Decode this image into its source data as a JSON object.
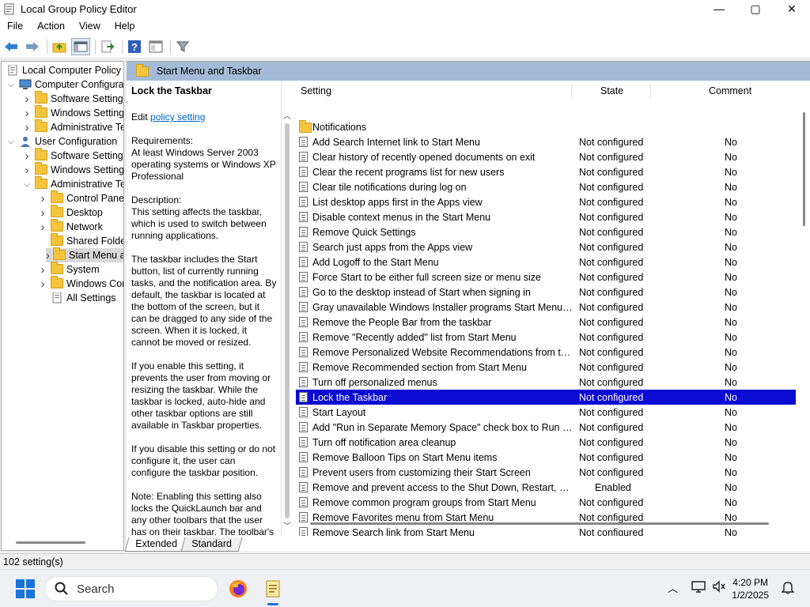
{
  "window": {
    "title": "Local Group Policy Editor",
    "controls": {
      "minimize": "—",
      "maximize": "▢",
      "close": "✕"
    }
  },
  "menu": [
    "File",
    "Action",
    "View",
    "Help"
  ],
  "toolbar": {
    "icons": [
      "back-arrow-icon",
      "forward-arrow-icon",
      "up-folder-icon",
      "show-hide-tree-icon",
      "export-list-icon",
      "help-icon",
      "properties-icon",
      "filter-icon"
    ]
  },
  "tree": [
    {
      "label": "Local Computer Policy",
      "level": 0,
      "expander": "",
      "icon": "computer-policy"
    },
    {
      "label": "Computer Configura",
      "level": 1,
      "expander": "down",
      "icon": "computer"
    },
    {
      "label": "Software Settings",
      "level": 2,
      "expander": "right",
      "icon": "folder"
    },
    {
      "label": "Windows Setting",
      "level": 2,
      "expander": "right",
      "icon": "folder"
    },
    {
      "label": "Administrative Te",
      "level": 2,
      "expander": "right",
      "icon": "folder"
    },
    {
      "label": "User Configuration",
      "level": 1,
      "expander": "down",
      "icon": "user"
    },
    {
      "label": "Software Settings",
      "level": 2,
      "expander": "right",
      "icon": "folder"
    },
    {
      "label": "Windows Setting",
      "level": 2,
      "expander": "right",
      "icon": "folder"
    },
    {
      "label": "Administrative Te",
      "level": 2,
      "expander": "down",
      "icon": "folder"
    },
    {
      "label": "Control Panel",
      "level": 3,
      "expander": "right",
      "icon": "folder"
    },
    {
      "label": "Desktop",
      "level": 3,
      "expander": "right",
      "icon": "folder"
    },
    {
      "label": "Network",
      "level": 3,
      "expander": "right",
      "icon": "folder"
    },
    {
      "label": "Shared Folder",
      "level": 3,
      "expander": "",
      "icon": "folder"
    },
    {
      "label": "Start Menu ar",
      "level": 3,
      "expander": "right",
      "icon": "folder",
      "selected": true
    },
    {
      "label": "System",
      "level": 3,
      "expander": "right",
      "icon": "folder"
    },
    {
      "label": "Windows Cor",
      "level": 3,
      "expander": "right",
      "icon": "folder"
    },
    {
      "label": "All Settings",
      "level": 3,
      "expander": "",
      "icon": "all-settings"
    }
  ],
  "header": {
    "title": "Start Menu and Taskbar"
  },
  "description": {
    "setting_title": "Lock the Taskbar",
    "edit_prefix": "Edit ",
    "edit_link": "policy setting",
    "requirements_label": "Requirements:",
    "requirements": "At least Windows Server 2003 operating systems or Windows XP Professional",
    "description_label": "Description:",
    "p1": "This setting affects the taskbar, which is used to switch between running applications.",
    "p2": "The taskbar includes the Start button, list of currently running tasks, and the notification area. By default, the taskbar is located at the bottom of the screen, but it can be dragged to any side of the screen. When it is locked, it cannot be moved or resized.",
    "p3": "If you enable this setting, it prevents the user from moving or resizing the taskbar. While the taskbar is locked, auto-hide and other taskbar options are still available in Taskbar properties.",
    "p4": "If you disable this setting or do not configure it, the user can configure the taskbar position.",
    "p5": "Note: Enabling this setting also locks the QuickLaunch bar and any other toolbars that the user has on their taskbar. The toolbar's"
  },
  "columns": {
    "setting": "Setting",
    "state": "State",
    "comment": "Comment"
  },
  "rows": [
    {
      "name": "Notifications",
      "state": "",
      "comment": "",
      "type": "folder"
    },
    {
      "name": "Add Search Internet link to Start Menu",
      "state": "Not configured",
      "comment": "No"
    },
    {
      "name": "Clear history of recently opened documents on exit",
      "state": "Not configured",
      "comment": "No"
    },
    {
      "name": "Clear the recent programs list for new users",
      "state": "Not configured",
      "comment": "No"
    },
    {
      "name": "Clear tile notifications during log on",
      "state": "Not configured",
      "comment": "No"
    },
    {
      "name": "List desktop apps first in the Apps view",
      "state": "Not configured",
      "comment": "No"
    },
    {
      "name": "Disable context menus in the Start Menu",
      "state": "Not configured",
      "comment": "No"
    },
    {
      "name": "Remove Quick Settings",
      "state": "Not configured",
      "comment": "No"
    },
    {
      "name": "Search just apps from the Apps view",
      "state": "Not configured",
      "comment": "No"
    },
    {
      "name": "Add Logoff to the Start Menu",
      "state": "Not configured",
      "comment": "No"
    },
    {
      "name": "Force Start to be either full screen size or menu size",
      "state": "Not configured",
      "comment": "No"
    },
    {
      "name": "Go to the desktop instead of Start when signing in",
      "state": "Not configured",
      "comment": "No"
    },
    {
      "name": "Gray unavailable Windows Installer programs Start Menu sh...",
      "state": "Not configured",
      "comment": "No"
    },
    {
      "name": "Remove the People Bar from the taskbar",
      "state": "Not configured",
      "comment": "No"
    },
    {
      "name": "Remove \"Recently added\" list from Start Menu",
      "state": "Not configured",
      "comment": "No"
    },
    {
      "name": "Remove Personalized Website Recommendations from the ...",
      "state": "Not configured",
      "comment": "No"
    },
    {
      "name": "Remove Recommended section from Start Menu",
      "state": "Not configured",
      "comment": "No"
    },
    {
      "name": "Turn off personalized menus",
      "state": "Not configured",
      "comment": "No"
    },
    {
      "name": "Lock the Taskbar",
      "state": "Not configured",
      "comment": "No",
      "selected": true
    },
    {
      "name": "Start Layout",
      "state": "Not configured",
      "comment": "No"
    },
    {
      "name": "Add \"Run in Separate Memory Space\" check box to Run dial...",
      "state": "Not configured",
      "comment": "No"
    },
    {
      "name": "Turn off notification area cleanup",
      "state": "Not configured",
      "comment": "No"
    },
    {
      "name": "Remove Balloon Tips on Start Menu items",
      "state": "Not configured",
      "comment": "No"
    },
    {
      "name": "Prevent users from customizing their Start Screen",
      "state": "Not configured",
      "comment": "No"
    },
    {
      "name": "Remove and prevent access to the Shut Down, Restart, Sleep...",
      "state": "Enabled",
      "comment": "No"
    },
    {
      "name": "Remove common program groups from Start Menu",
      "state": "Not configured",
      "comment": "No"
    },
    {
      "name": "Remove Favorites menu from Start Menu",
      "state": "Not configured",
      "comment": "No"
    },
    {
      "name": "Remove Search link from Start Menu",
      "state": "Not configured",
      "comment": "No"
    }
  ],
  "tabs": [
    "Extended",
    "Standard"
  ],
  "status": "102 setting(s)",
  "taskbar": {
    "search_placeholder": "Search",
    "time": "4:20 PM",
    "date": "1/2/2025",
    "accent": "#1a73d9"
  },
  "colors": {
    "selection": "#0a0ad2",
    "header_band": "#a3bbd6",
    "link": "#0066cc"
  }
}
